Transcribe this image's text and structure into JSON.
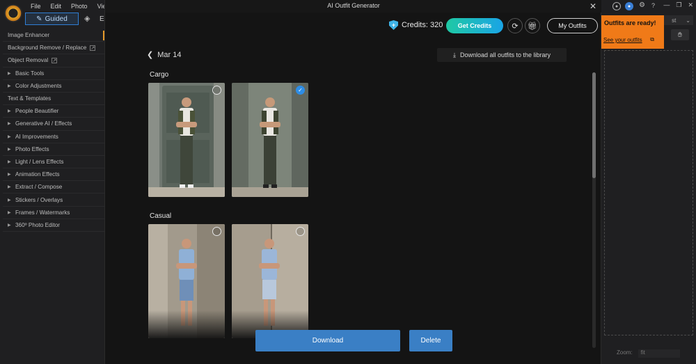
{
  "menu": {
    "file": "File",
    "edit": "Edit",
    "photo": "Photo",
    "view": "View"
  },
  "mode": {
    "guided": "Guided",
    "expert_partial": "E"
  },
  "nav_items": [
    {
      "label": "Image Enhancer",
      "caret": false,
      "ext": false
    },
    {
      "label": "Background Remove / Replace",
      "caret": false,
      "ext": true
    },
    {
      "label": "Object Removal",
      "caret": false,
      "ext": true
    },
    {
      "label": "Basic Tools",
      "caret": true
    },
    {
      "label": "Color Adjustments",
      "caret": true
    },
    {
      "label": "Text & Templates",
      "caret": false
    },
    {
      "label": "People Beautifier",
      "caret": true
    },
    {
      "label": "Generative AI / Effects",
      "caret": true
    },
    {
      "label": "AI Improvements",
      "caret": true
    },
    {
      "label": "Photo Effects",
      "caret": true
    },
    {
      "label": "Light / Lens Effects",
      "caret": true
    },
    {
      "label": "Animation Effects",
      "caret": true
    },
    {
      "label": "Extract / Compose",
      "caret": true
    },
    {
      "label": "Stickers / Overlays",
      "caret": true
    },
    {
      "label": "Frames / Watermarks",
      "caret": true
    },
    {
      "label": "360º Photo Editor",
      "caret": true
    }
  ],
  "dialog": {
    "title": "AI Outfit Generator",
    "close": "✕",
    "credits_label": "Credits: 320",
    "get_credits": "Get Credits",
    "my_outfits": "My Outfits",
    "date": "Mar 14",
    "download_all": "Download all outfits to the library",
    "sections": [
      {
        "label": "Cargo",
        "images": [
          {
            "selected": false
          },
          {
            "selected": true
          }
        ]
      },
      {
        "label": "Casual",
        "images": [
          {
            "selected": false
          },
          {
            "selected": false
          }
        ]
      }
    ],
    "download": "Download",
    "delete": "Delete"
  },
  "toast": {
    "title": "Outfits are ready!",
    "link": "See your outfits"
  },
  "right_panel": {
    "select_partial": "st",
    "zoom_label": "Zoom:",
    "zoom_value": "fit",
    "help": "?"
  },
  "colors": {
    "accent_blue": "#3a7fc5",
    "toast_orange": "#f07a18",
    "check_blue": "#2d8de6"
  }
}
